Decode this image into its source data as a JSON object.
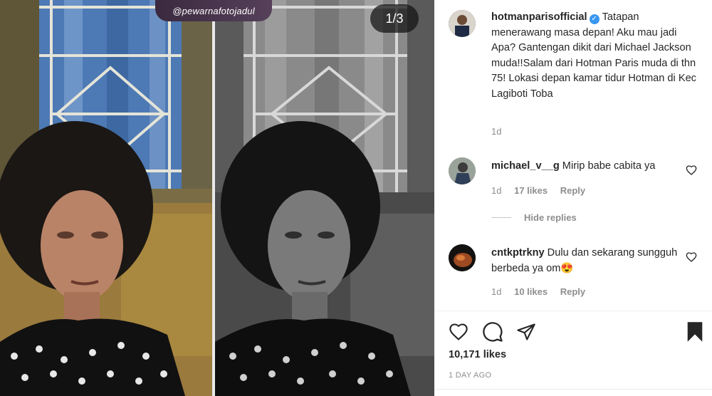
{
  "media": {
    "watermark": "@pewarnafotojadul",
    "counter": "1/3"
  },
  "post": {
    "author": "hotmanparisofficial",
    "verified_icon": "verified-badge-icon",
    "caption": "Tatapan menerawang masa depan! Aku mau jadi Apa? Gantengan dikit dari Michael Jackson muda!!Salam dari Hotman Paris muda di thn 75! Lokasi depan kamar tidur Hotman di Kec Lagiboti Toba",
    "caption_age": "1d"
  },
  "comments": [
    {
      "user": "michael_v__g",
      "text": "Mirip babe cabita ya",
      "age": "1d",
      "likes": "17 likes",
      "reply": "Reply"
    },
    {
      "user": "cntkptrkny",
      "text": "Dulu dan sekarang sungguh berbeda ya om😍",
      "age": "1d",
      "likes": "10 likes",
      "reply": "Reply"
    }
  ],
  "hide_replies": "Hide replies",
  "footer": {
    "likes": "10,171 likes",
    "date": "1 DAY AGO"
  },
  "colors": {
    "accent": "#3897f0",
    "muted": "#8e8e8e",
    "text": "#262626"
  }
}
